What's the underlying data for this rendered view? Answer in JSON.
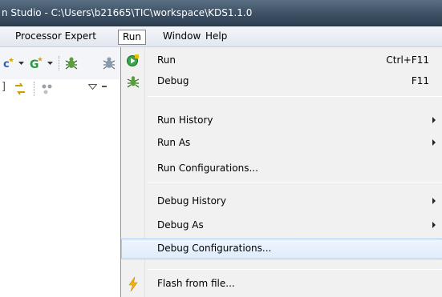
{
  "window": {
    "title": "n Studio - C:\\Users\\b21665\\TIC\\workspace\\KDS1.1.0"
  },
  "menubar": {
    "items": [
      {
        "label": "Processor Expert"
      },
      {
        "label": "Run",
        "open": true
      },
      {
        "label": "Window"
      },
      {
        "label": "Help"
      }
    ]
  },
  "toolbar": {
    "icons": [
      "new-c-class-icon",
      "dropdown-arrow-icon",
      "new-cpp-icon",
      "dropdown-arrow-icon",
      "debug-bug-icon",
      "link-icon",
      "nodes-icon",
      "view-menu-icon"
    ]
  },
  "run_menu": {
    "items": [
      {
        "label": "Run",
        "accel": "Ctrl+F11",
        "icon": "run-icon"
      },
      {
        "label": "Debug",
        "accel": "F11",
        "icon": "debug-icon"
      },
      {
        "label": "Run History",
        "submenu": true
      },
      {
        "label": "Run As",
        "submenu": true
      },
      {
        "label": "Run Configurations..."
      },
      {
        "label": "Debug History",
        "submenu": true
      },
      {
        "label": "Debug As",
        "submenu": true
      },
      {
        "label": "Debug Configurations...",
        "highlighted": true
      },
      {
        "label": "Flash from file...",
        "icon": "flash-lightning-icon"
      }
    ]
  },
  "colors": {
    "highlight_bg": "#dfecfb",
    "highlight_border": "#a8c8ec",
    "titlebar": "#3f5266",
    "menu_bg": "#f1f1f1"
  }
}
